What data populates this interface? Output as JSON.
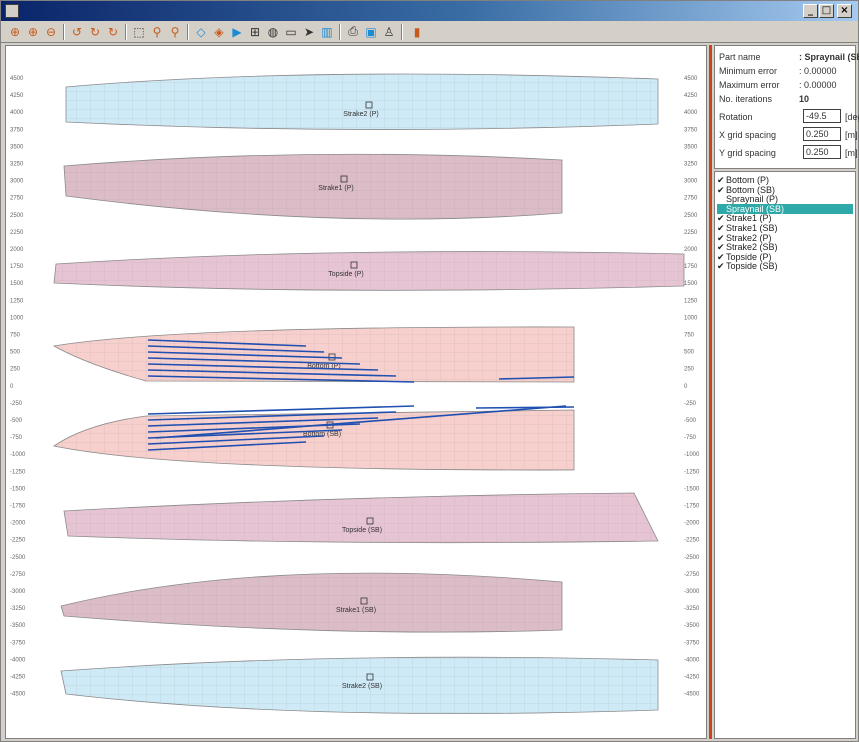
{
  "window": {
    "min": "_",
    "max": "□",
    "close": "×"
  },
  "toolbar": {
    "icons": [
      "zoom-in-all-icon",
      "zoom-all-icon",
      "zoom-out-all-icon",
      "rotate-left-icon",
      "rotate-icon",
      "rotate-right-icon",
      "zoom-window-icon",
      "zoom-in-icon",
      "zoom-out-icon",
      "fill-icon",
      "erase-icon",
      "play-icon",
      "grid-icon",
      "globe-icon",
      "cursor-icon",
      "arrow-icon",
      "table-icon",
      "print-icon",
      "save-icon",
      "person-icon",
      "door-icon"
    ]
  },
  "properties": {
    "part_name_label": "Part name",
    "part_name_value": ": Spraynail (SB)",
    "min_error_label": "Minimum error",
    "min_error_value": ": 0.00000",
    "max_error_label": "Maximum error",
    "max_error_value": ": 0.00000",
    "iterations_label": "No. iterations",
    "iterations_value": "10",
    "rotation_label": "Rotation",
    "rotation_value": "-49.5",
    "rotation_unit": "[deg]",
    "xgrid_label": "X grid spacing",
    "xgrid_value": "0.250",
    "xgrid_unit": "[m]",
    "ygrid_label": "Y grid spacing",
    "ygrid_value": "0.250",
    "ygrid_unit": "[m]"
  },
  "parts": [
    {
      "label": "Bottom (P)",
      "checked": true,
      "selected": false
    },
    {
      "label": "Bottom (SB)",
      "checked": true,
      "selected": false
    },
    {
      "label": "Spraynail (P)",
      "checked": false,
      "selected": false
    },
    {
      "label": "Spraynail (SB)",
      "checked": false,
      "selected": true
    },
    {
      "label": "Strake1 (P)",
      "checked": true,
      "selected": false
    },
    {
      "label": "Strake1 (SB)",
      "checked": true,
      "selected": false
    },
    {
      "label": "Strake2 (P)",
      "checked": true,
      "selected": false
    },
    {
      "label": "Strake2 (SB)",
      "checked": true,
      "selected": false
    },
    {
      "label": "Topside (P)",
      "checked": true,
      "selected": false
    },
    {
      "label": "Topside (SB)",
      "checked": true,
      "selected": false
    }
  ],
  "y_ticks": [
    "4500",
    "4250",
    "4000",
    "3750",
    "3500",
    "3250",
    "3000",
    "2750",
    "2500",
    "2250",
    "2000",
    "1750",
    "1500",
    "1250",
    "1000",
    "750",
    "500",
    "250",
    "0",
    "-250",
    "-500",
    "-750",
    "-1000",
    "-1250",
    "-1500",
    "-1750",
    "-2000",
    "-2250",
    "-2500",
    "-2750",
    "-3000",
    "-3250",
    "-3500",
    "-3750",
    "-4000",
    "-4250",
    "-4500"
  ],
  "plates": [
    {
      "label": "Strake2 (P)",
      "color": "#cfeaf7"
    },
    {
      "label": "Strake1 (P)",
      "color": "#dcbcc6"
    },
    {
      "label": "Topside (P)",
      "color": "#e7c4d4"
    },
    {
      "label": "Bottom (P)",
      "color": "#f7cfcc"
    },
    {
      "label": "Bottom (SB)",
      "color": "#f7cfcc"
    },
    {
      "label": "Topside (SB)",
      "color": "#e7c4d4"
    },
    {
      "label": "Strake1 (SB)",
      "color": "#dcbcc6"
    },
    {
      "label": "Strake2 (SB)",
      "color": "#cfeaf7"
    }
  ],
  "colors": {
    "accent": "#c8441e",
    "selection": "#2ea8a8",
    "stiffener": "#1f4fb0"
  }
}
